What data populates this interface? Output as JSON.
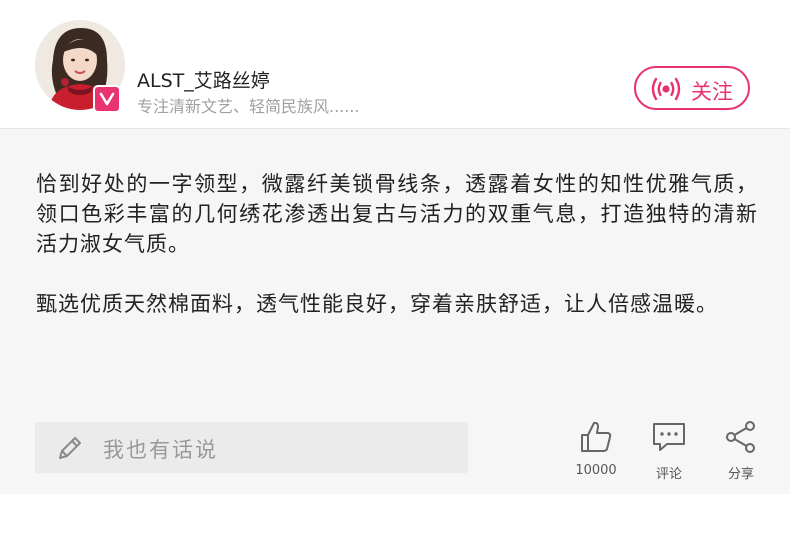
{
  "header": {
    "username": "ALST_艾路丝婷",
    "bio": "专注清新文艺、轻简民族风......",
    "follow_label": "关注",
    "avatar_icon": "avatar-photo",
    "badge_icon": "verified-v-icon",
    "accent_color": "#e8336f"
  },
  "content": {
    "paragraphs": [
      "恰到好处的一字领型，微露纤美锁骨线条，透露着女性的知性优雅气质，领口色彩丰富的几何绣花渗透出复古与活力的双重气息，打造独特的清新活力淑女气质。",
      "甄选优质天然棉面料，透气性能良好，穿着亲肤舒适，让人倍感温暖。"
    ]
  },
  "footer": {
    "comment_placeholder": "我也有话说",
    "like_count": "10000",
    "comment_label": "评论",
    "share_label": "分享",
    "icons": [
      "pencil-icon",
      "thumbs-up-icon",
      "comment-icon",
      "share-icon"
    ]
  }
}
